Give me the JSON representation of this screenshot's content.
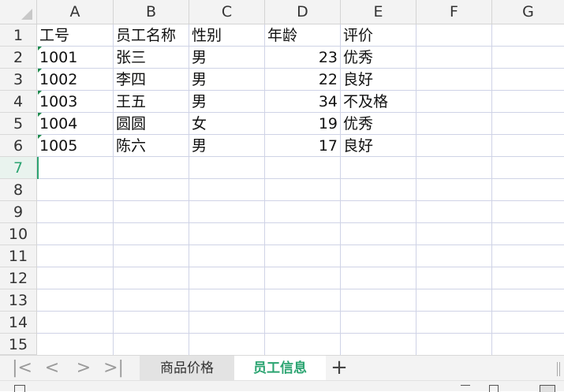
{
  "columns": [
    "A",
    "B",
    "C",
    "D",
    "E",
    "F",
    "G"
  ],
  "rows": [
    "1",
    "2",
    "3",
    "4",
    "5",
    "6",
    "7",
    "8",
    "9",
    "10",
    "11",
    "12",
    "13",
    "14",
    "15"
  ],
  "active_row": "7",
  "cells": {
    "A1": "工号",
    "B1": "员工名称",
    "C1": "性别",
    "D1": "年龄",
    "E1": "评价",
    "A2": "1001",
    "B2": "张三",
    "C2": "男",
    "D2": "23",
    "E2": "优秀",
    "A3": "1002",
    "B3": "李四",
    "C3": "男",
    "D3": "22",
    "E3": "良好",
    "A4": "1003",
    "B4": "王五",
    "C4": "男",
    "D4": "34",
    "E4": "不及格",
    "A5": "1004",
    "B5": "圆圆",
    "C5": "女",
    "D5": "19",
    "E5": "优秀",
    "A6": "1005",
    "B6": "陈六",
    "C6": "男",
    "D6": "17",
    "E6": "良好"
  },
  "sheet_nav": {
    "first": "|<",
    "prev": "<",
    "next": ">",
    "last": ">|"
  },
  "tabs": [
    {
      "label": "商品价格",
      "active": false
    },
    {
      "label": "员工信息",
      "active": true
    }
  ],
  "add_tab_label": "+",
  "accent_color": "#2ba471"
}
